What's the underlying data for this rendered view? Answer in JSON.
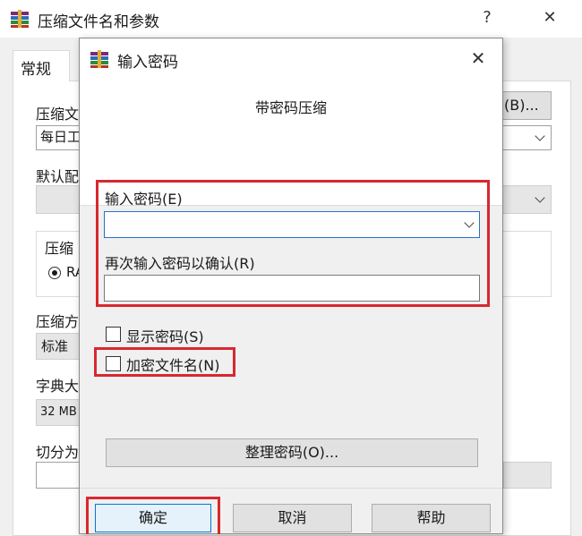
{
  "main_window": {
    "title": "压缩文件名和参数",
    "help_glyph": "?",
    "close_glyph": "✕",
    "tab_general": "常规",
    "archive_name_label": "压缩文",
    "archive_name_value": "每日工",
    "browse_button": "(B)...",
    "default_profile_label": "默认配",
    "format_group_label": "压缩",
    "format_radio_label": "RA",
    "method_label": "压缩方",
    "method_value": "标准",
    "dictionary_label": "字典大",
    "dictionary_value": "32 MB",
    "split_label": "切分为"
  },
  "dialog": {
    "title": "输入密码",
    "close_glyph": "✕",
    "subtitle": "带密码压缩",
    "enter_password_label": "输入密码(E)",
    "enter_password_value": "",
    "reenter_password_label": "再次输入密码以确认(R)",
    "reenter_password_value": "",
    "show_password_label": "显示密码(S)",
    "show_password_checked": false,
    "encrypt_filenames_label": "加密文件名(N)",
    "encrypt_filenames_checked": false,
    "organize_button": "整理密码(O)...",
    "ok_button": "确定",
    "cancel_button": "取消",
    "help_button": "帮助"
  },
  "colors": {
    "highlight_red": "#d8282f",
    "focus_blue": "#2a6fc9"
  }
}
